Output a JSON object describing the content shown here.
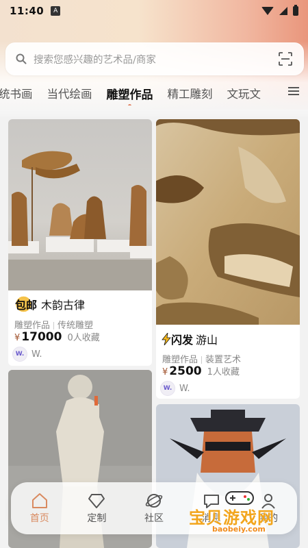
{
  "status": {
    "time": "11:40",
    "notif": "A"
  },
  "search": {
    "placeholder": "搜索您感兴趣的艺术品/商家"
  },
  "tabs": [
    {
      "label": "统书画"
    },
    {
      "label": "当代绘画"
    },
    {
      "label": "雕塑作品",
      "active": true
    },
    {
      "label": "精工雕刻"
    },
    {
      "label": "文玩文"
    }
  ],
  "cards": [
    {
      "badge": "包邮",
      "title": "木韵古律",
      "cats": [
        "雕塑作品",
        "传统雕塑"
      ],
      "currency": "¥",
      "price": "17000",
      "fav": "0人收藏",
      "avatar": "W.",
      "seller": "W."
    },
    {
      "badge": "闪发",
      "title": "游山",
      "cats": [
        "雕塑作品",
        "装置艺术"
      ],
      "currency": "¥",
      "price": "2500",
      "fav": "1人收藏",
      "avatar": "W.",
      "seller": "W."
    }
  ],
  "nav": [
    {
      "label": "首页",
      "icon": "home-icon",
      "active": true
    },
    {
      "label": "定制",
      "icon": "diamond-icon"
    },
    {
      "label": "社区",
      "icon": "planet-icon"
    },
    {
      "label": "消息",
      "icon": "message-icon"
    },
    {
      "label": "我的",
      "icon": "profile-icon"
    }
  ],
  "watermark": {
    "title": "宝贝游戏网",
    "url": "baobeiy.com"
  },
  "colors": {
    "accent": "#d98a60",
    "price": "#a0522d",
    "badge": "#f5c24a"
  }
}
